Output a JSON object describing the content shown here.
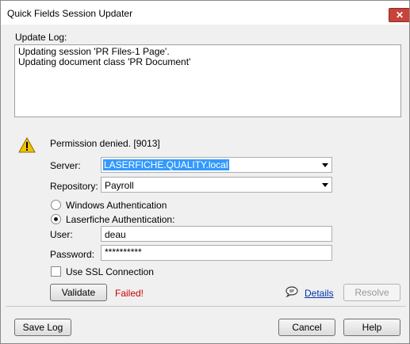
{
  "window": {
    "title": "Quick Fields Session Updater",
    "close_glyph": "✕"
  },
  "log": {
    "label": "Update Log:",
    "lines": [
      "Updating session 'PR Files-1 Page'.",
      "Updating document class 'PR Document'"
    ]
  },
  "status": {
    "message": "Permission denied. [9013]",
    "icon": "warning-icon"
  },
  "form": {
    "server_label": "Server:",
    "server_value": "LASERFICHE.QUALITY.local",
    "repository_label": "Repository:",
    "repository_value": "Payroll",
    "auth_windows_label": "Windows Authentication",
    "auth_laserfiche_label": "Laserfiche Authentication:",
    "user_label": "User:",
    "user_value": "deau",
    "password_label": "Password:",
    "password_value": "**********",
    "ssl_label": "Use SSL Connection"
  },
  "actions": {
    "validate_label": "Validate",
    "validate_result": "Failed!",
    "details_label": "Details",
    "resolve_label": "Resolve"
  },
  "footer": {
    "save_log_label": "Save Log",
    "cancel_label": "Cancel",
    "help_label": "Help"
  },
  "colors": {
    "selection": "#3399ff",
    "failed": "#cc0000",
    "link": "#0033aa",
    "close": "#c8433a"
  }
}
